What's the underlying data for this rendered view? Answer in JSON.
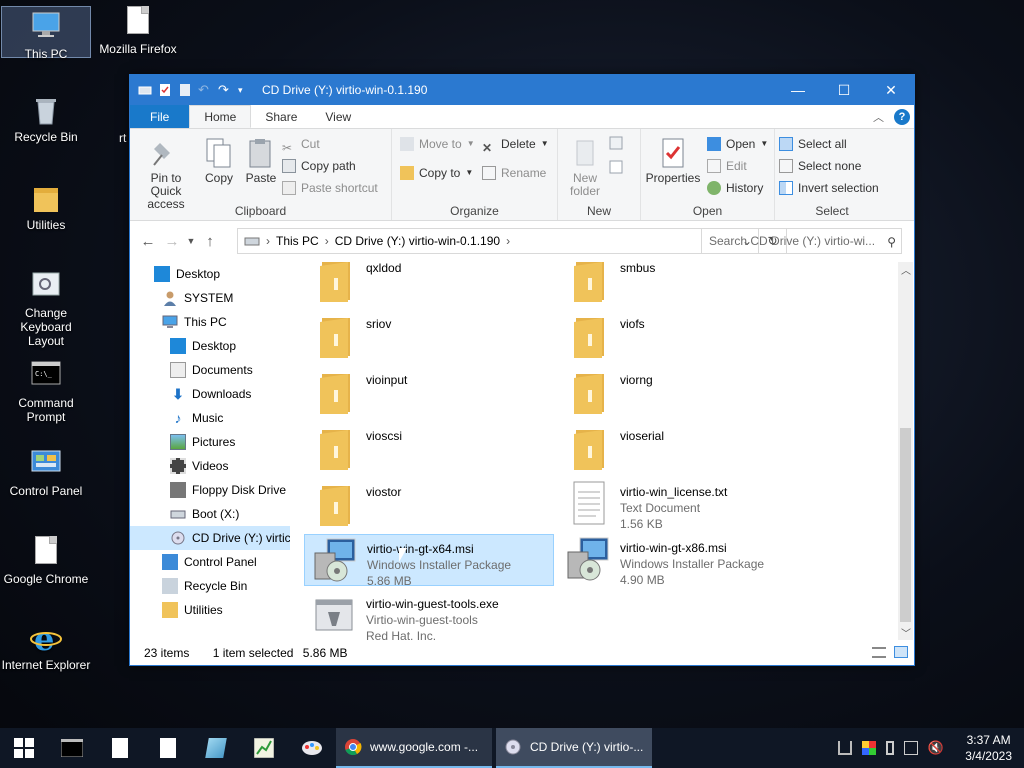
{
  "desktop": {
    "icons": [
      {
        "label": "This PC"
      },
      {
        "label": "Mozilla Firefox"
      },
      {
        "label": "Recycle Bin"
      },
      {
        "label": "Utilities"
      },
      {
        "label": "Change Keyboard Layout"
      },
      {
        "label": "Command Prompt"
      },
      {
        "label": "Control Panel"
      },
      {
        "label": "Google Chrome"
      },
      {
        "label": "Internet Explorer"
      }
    ],
    "partial_label": "rt"
  },
  "window": {
    "title": "CD Drive (Y:) virtio-win-0.1.190",
    "controls": {
      "minimize": "—",
      "maximize": "☐",
      "close": "✕"
    }
  },
  "ribbon": {
    "tabs": [
      "File",
      "Home",
      "Share",
      "View"
    ],
    "clipboard": {
      "label": "Clipboard",
      "pin": "Pin to Quick access",
      "copy": "Copy",
      "paste": "Paste",
      "cut": "Cut",
      "copy_path": "Copy path",
      "paste_shortcut": "Paste shortcut"
    },
    "organize": {
      "label": "Organize",
      "move_to": "Move to",
      "copy_to": "Copy to",
      "delete": "Delete",
      "rename": "Rename"
    },
    "new": {
      "label": "New",
      "new_folder": "New folder"
    },
    "open": {
      "label": "Open",
      "properties": "Properties",
      "open": "Open",
      "edit": "Edit",
      "history": "History"
    },
    "select": {
      "label": "Select",
      "select_all": "Select all",
      "select_none": "Select none",
      "invert": "Invert selection"
    }
  },
  "navbar": {
    "breadcrumb": [
      "This PC",
      "CD Drive (Y:) virtio-win-0.1.190"
    ],
    "search_placeholder": "Search CD Drive (Y:) virtio-wi..."
  },
  "navpane": [
    {
      "label": "Desktop",
      "level": 0
    },
    {
      "label": "SYSTEM",
      "level": 1
    },
    {
      "label": "This PC",
      "level": 1
    },
    {
      "label": "Desktop",
      "level": 2
    },
    {
      "label": "Documents",
      "level": 2
    },
    {
      "label": "Downloads",
      "level": 2
    },
    {
      "label": "Music",
      "level": 2
    },
    {
      "label": "Pictures",
      "level": 2
    },
    {
      "label": "Videos",
      "level": 2
    },
    {
      "label": "Floppy Disk Drive",
      "level": 2
    },
    {
      "label": "Boot (X:)",
      "level": 2
    },
    {
      "label": "CD Drive (Y:) virtic",
      "level": 2,
      "selected": true
    },
    {
      "label": "Control Panel",
      "level": 1
    },
    {
      "label": "Recycle Bin",
      "level": 1
    },
    {
      "label": "Utilities",
      "level": 1
    }
  ],
  "files": [
    {
      "name": "qxldod",
      "kind": "folder"
    },
    {
      "name": "smbus",
      "kind": "folder"
    },
    {
      "name": "sriov",
      "kind": "folder"
    },
    {
      "name": "viofs",
      "kind": "folder"
    },
    {
      "name": "vioinput",
      "kind": "folder"
    },
    {
      "name": "viorng",
      "kind": "folder"
    },
    {
      "name": "vioscsi",
      "kind": "folder"
    },
    {
      "name": "vioserial",
      "kind": "folder"
    },
    {
      "name": "viostor",
      "kind": "folder"
    },
    {
      "name": "virtio-win_license.txt",
      "kind": "text",
      "type": "Text Document",
      "size": "1.56 KB"
    },
    {
      "name": "virtio-win-gt-x64.msi",
      "kind": "msi",
      "type": "Windows Installer Package",
      "size": "5.86 MB",
      "selected": true
    },
    {
      "name": "virtio-win-gt-x86.msi",
      "kind": "msi",
      "type": "Windows Installer Package",
      "size": "4.90 MB"
    },
    {
      "name": "virtio-win-guest-tools.exe",
      "kind": "exe",
      "type": "Virtio-win-guest-tools",
      "size": "Red Hat, Inc."
    }
  ],
  "status": {
    "items": "23 items",
    "selected": "1 item selected",
    "size": "5.86 MB"
  },
  "taskbar": {
    "chrome_label": "www.google.com -...",
    "explorer_label": "CD Drive (Y:) virtio-...",
    "time": "3:37 AM",
    "date": "3/4/2023"
  },
  "colors": {
    "accent": "#2b79d0",
    "selection": "#cce8ff",
    "folder": "#f0c35a"
  }
}
